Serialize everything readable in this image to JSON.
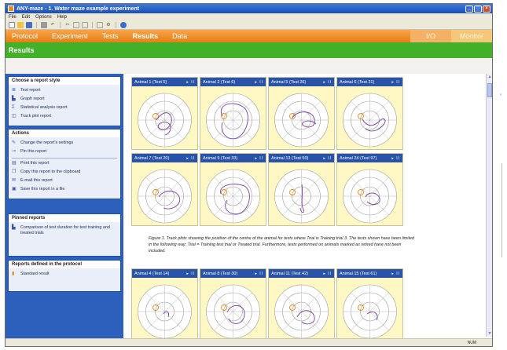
{
  "window": {
    "title": "ANY-maze - 1. Water maze example experiment",
    "buttons": [
      "_",
      "□",
      "×"
    ]
  },
  "menu": [
    "File",
    "Edit",
    "Options",
    "Help"
  ],
  "toolbar_icons": [
    "new-icon",
    "open-icon",
    "save-icon",
    "print-icon",
    "undo-icon",
    "cut-icon",
    "copy-icon",
    "paste-icon",
    "view-icon",
    "settings-icon",
    "help-icon"
  ],
  "nav": {
    "tabs": [
      "Protocol",
      "Experiment",
      "Tests",
      "Results",
      "Data"
    ],
    "active": "Results",
    "io": "I/O",
    "monitor": "Monitor"
  },
  "section_title": "Results",
  "sidebar": {
    "report_style": {
      "title": "Choose a report style",
      "items": [
        "Text report",
        "Graph report",
        "Statistical analysis report",
        "Track plot report"
      ]
    },
    "actions": {
      "title": "Actions",
      "items_a": [
        "Change the report's settings",
        "Pin this report"
      ],
      "items_b": [
        "Print this report",
        "Copy this report to the clipboard",
        "E-mail this report",
        "Save this report in a file"
      ]
    },
    "pinned": {
      "title": "Pinned reports",
      "items": [
        "Comparison of test duration for test training and treated trials"
      ]
    },
    "protocol_reports": {
      "title": "Reports defined in the protocol",
      "items": [
        "Standard result"
      ]
    }
  },
  "plots_row1": [
    {
      "label": "Animal 1 (Test 5)"
    },
    {
      "label": "Animal 2 (Test 6)"
    },
    {
      "label": "Animal 5 (Test 26)"
    },
    {
      "label": "Animal 6 (Test 21)"
    }
  ],
  "plots_row2": [
    {
      "label": "Animal 7 (Test 20)"
    },
    {
      "label": "Animal 9 (Test 33)"
    },
    {
      "label": "Animal 13 (Test 50)"
    },
    {
      "label": "Animal 24 (Test 97)"
    }
  ],
  "plots_row3": [
    {
      "label": "Animal 4 (Test 14)"
    },
    {
      "label": "Animal 8 (Test 30)"
    },
    {
      "label": "Animal 11 (Test 42)"
    },
    {
      "label": "Animal 15 (Test 61)"
    }
  ],
  "plot_controls": "▸ II",
  "caption": "Figure 1. Track plots showing the position of the centre of the animal for tests where Trial is Training trial 3. The tests shown have been limited in the following way: Trial = Training test trial or Treated trial. Furthermore, tests performed on animals marked as retired have not been included.",
  "status": {
    "num": "NUM"
  },
  "colors": {
    "nav": "#e67e14",
    "section": "#43b02a",
    "sidebar": "#2d5fbd",
    "plot_bg": "#fff7c4",
    "track": "#7a3fa0"
  }
}
